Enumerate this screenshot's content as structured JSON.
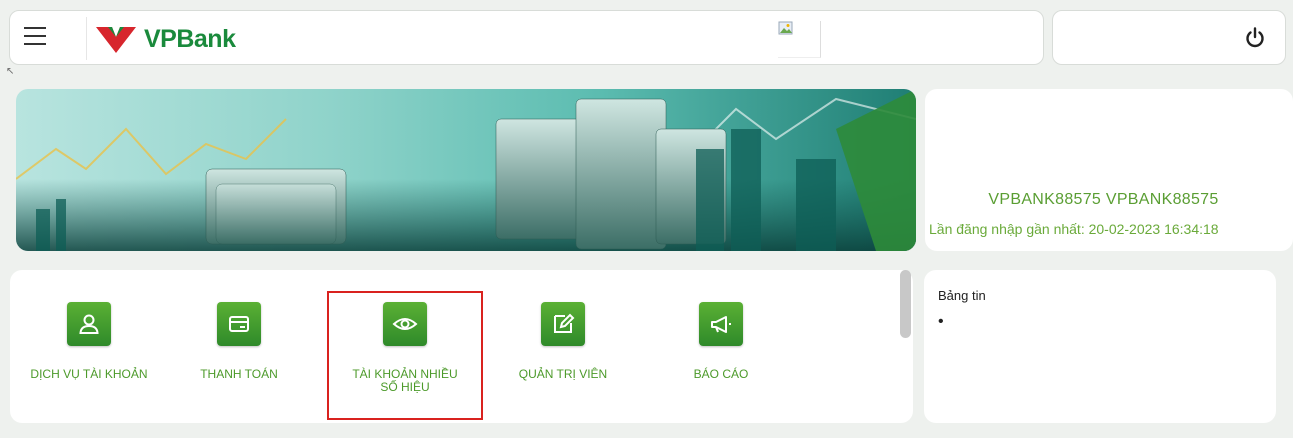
{
  "brand": {
    "name": "VPBank",
    "accent": "#1a8a3c",
    "logo_red": "#d7262d"
  },
  "header": {
    "menu_icon": "hamburger-icon",
    "power_icon": "power-icon"
  },
  "user": {
    "display_name": "VPBANK88575 VPBANK88575",
    "last_login": "Lần đăng nhập gần nhất: 20-02-2023 16:34:18"
  },
  "services": [
    {
      "label": "DỊCH VỤ TÀI KHOẢN",
      "icon": "user-icon"
    },
    {
      "label": "THANH TOÁN",
      "icon": "card-icon"
    },
    {
      "label": "TÀI KHOẢN NHIỀU SỐ HIỆU",
      "icon": "eye-icon"
    },
    {
      "label": "QUẢN TRỊ VIÊN",
      "icon": "edit-icon"
    },
    {
      "label": "BÁO CÁO",
      "icon": "megaphone-icon"
    }
  ],
  "news": {
    "title": "Bảng tin",
    "bullet": "•"
  }
}
